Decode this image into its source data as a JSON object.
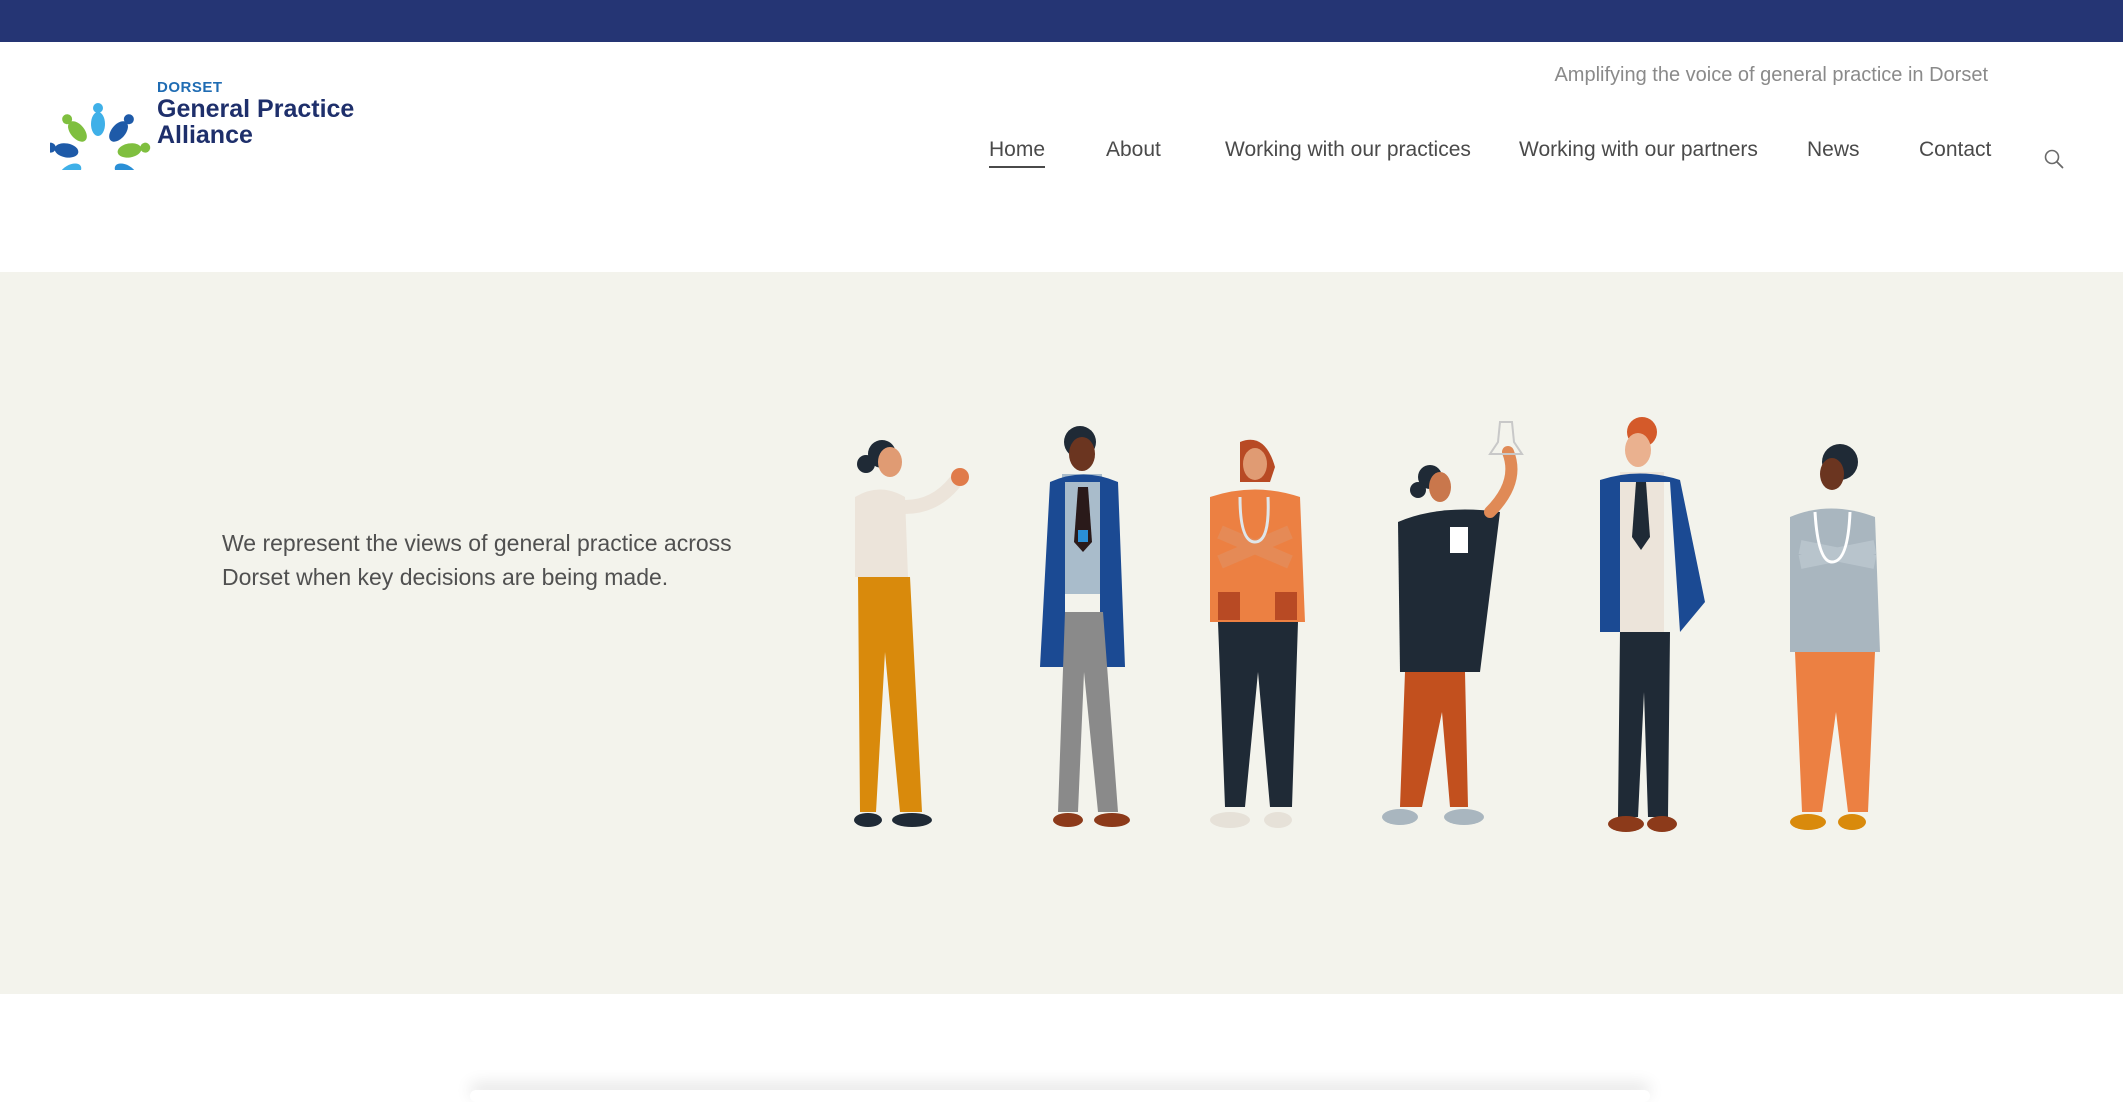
{
  "logo": {
    "small": "DORSET",
    "line1": "General Practice",
    "line2": "Alliance",
    "colors": [
      "#2a8fd6",
      "#1e5aa8",
      "#7fbf3f",
      "#3fb0e8"
    ]
  },
  "header": {
    "tagline": "Amplifying the voice of general practice in Dorset"
  },
  "nav": {
    "items": [
      {
        "label": "Home",
        "active": true
      },
      {
        "label": "About"
      },
      {
        "label": "Working with our practices"
      },
      {
        "label": "Working with our partners"
      },
      {
        "label": "News"
      },
      {
        "label": "Contact"
      }
    ],
    "search_icon": "search-icon"
  },
  "hero": {
    "text": "We represent the views of general practice across Dorset when key decisions are being made.",
    "illustration": "group-of-six-healthcare-professionals"
  },
  "colors": {
    "top_bar": "#253574",
    "hero_bg": "#f3f3ec",
    "brand_navy": "#1e2f6b"
  }
}
